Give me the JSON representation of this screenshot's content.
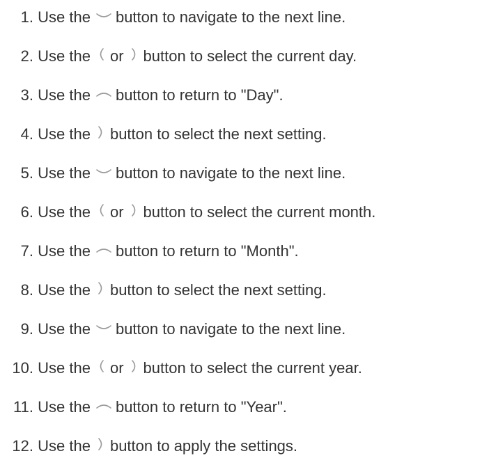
{
  "icon_color": "#9a9a9a",
  "steps": [
    {
      "n": "1.",
      "icon1": "chevron-down-icon",
      "mid": "",
      "icon2": "",
      "text_before": "Use the",
      "text_after": "button to navigate to the next line."
    },
    {
      "n": "2.",
      "icon1": "chevron-left-icon",
      "mid": "or",
      "icon2": "chevron-right-icon",
      "text_before": "Use the",
      "text_after": "button to select the current day."
    },
    {
      "n": "3.",
      "icon1": "chevron-up-icon",
      "mid": "",
      "icon2": "",
      "text_before": "Use the",
      "text_after": "button to return to \"Day\"."
    },
    {
      "n": "4.",
      "icon1": "chevron-right-icon",
      "mid": "",
      "icon2": "",
      "text_before": "Use the",
      "text_after": "button to select the next setting."
    },
    {
      "n": "5.",
      "icon1": "chevron-down-icon",
      "mid": "",
      "icon2": "",
      "text_before": "Use the",
      "text_after": "button to navigate to the next line."
    },
    {
      "n": "6.",
      "icon1": "chevron-left-icon",
      "mid": "or",
      "icon2": "chevron-right-icon",
      "text_before": "Use the",
      "text_after": "button to select the current month."
    },
    {
      "n": "7.",
      "icon1": "chevron-up-icon",
      "mid": "",
      "icon2": "",
      "text_before": "Use the",
      "text_after": "button to return to \"Month\"."
    },
    {
      "n": "8.",
      "icon1": "chevron-right-icon",
      "mid": "",
      "icon2": "",
      "text_before": "Use the",
      "text_after": "button to select the next setting."
    },
    {
      "n": "9.",
      "icon1": "chevron-down-icon",
      "mid": "",
      "icon2": "",
      "text_before": "Use the",
      "text_after": "button to navigate to the next line."
    },
    {
      "n": "10.",
      "icon1": "chevron-left-icon",
      "mid": "or",
      "icon2": "chevron-right-icon",
      "text_before": "Use the",
      "text_after": "button to select the current year."
    },
    {
      "n": "11.",
      "icon1": "chevron-up-icon",
      "mid": "",
      "icon2": "",
      "text_before": "Use the",
      "text_after": "button to return to \"Year\"."
    },
    {
      "n": "12.",
      "icon1": "chevron-right-icon",
      "mid": "",
      "icon2": "",
      "text_before": "Use the",
      "text_after": "button to apply the settings."
    }
  ]
}
